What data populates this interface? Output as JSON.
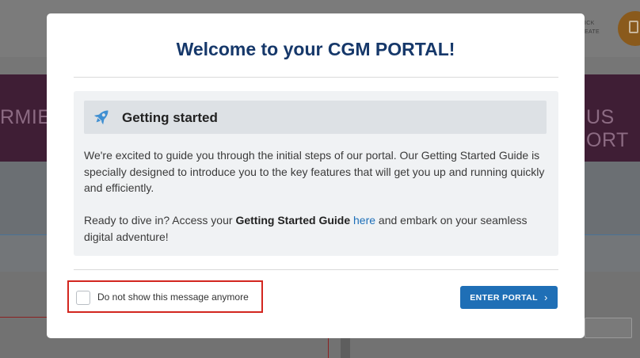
{
  "background": {
    "quick_text_line1": "ICK",
    "quick_text_line2": "EATE",
    "banner_left_text": "RMIER",
    "banner_right_text": "US ORT"
  },
  "modal": {
    "title": "Welcome to your CGM PORTAL!",
    "card": {
      "icon": "rocket-icon",
      "title": "Getting started",
      "paragraph1": "We're excited to guide you through the initial steps of our portal. Our Getting Started Guide is specially designed to introduce you to the key features that will get you up and running quickly and efficiently.",
      "paragraph2_prefix": "Ready to dive in? Access your ",
      "paragraph2_bold": "Getting Started Guide",
      "paragraph2_link": "here",
      "paragraph2_suffix": " and embark on your seamless digital adventure!"
    },
    "checkbox_label": "Do not show this message anymore",
    "checkbox_checked": false,
    "enter_button_label": "ENTER PORTAL",
    "enter_button_icon": "chevron-right-icon"
  },
  "colors": {
    "title": "#16386a",
    "button": "#1f6fb6",
    "link": "#1d6fb8",
    "highlight_border": "#d3261f",
    "rocket": "#3f8fd2"
  }
}
